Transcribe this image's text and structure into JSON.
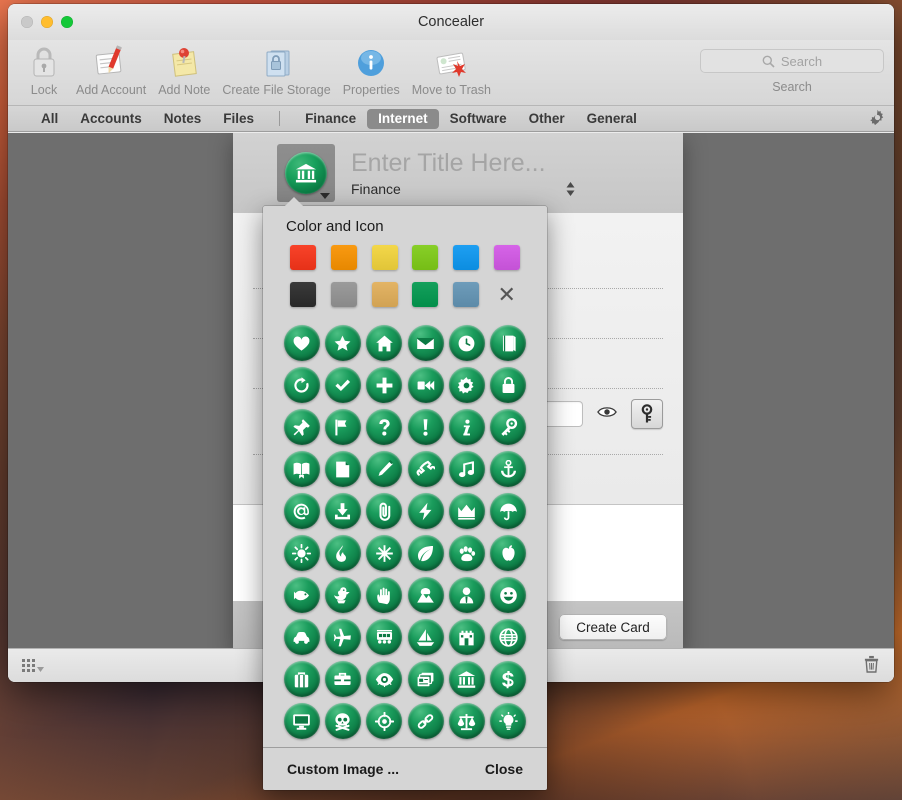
{
  "window": {
    "title": "Concealer",
    "traffic_lights": [
      "close",
      "minimize",
      "maximize"
    ]
  },
  "toolbar": {
    "items": [
      {
        "label": "Lock",
        "icon": "padlock-icon"
      },
      {
        "label": "Add Account",
        "icon": "note-pencil-icon"
      },
      {
        "label": "Add Note",
        "icon": "sticky-note-icon"
      },
      {
        "label": "Create File Storage",
        "icon": "locked-folder-icon"
      },
      {
        "label": "Properties",
        "icon": "info-circle-icon"
      },
      {
        "label": "Move to Trash",
        "icon": "card-delete-icon"
      }
    ],
    "search": {
      "placeholder": "Search",
      "label": "Search"
    }
  },
  "filterbar": {
    "left_tabs": [
      "All",
      "Accounts",
      "Notes",
      "Files"
    ],
    "right_tabs": [
      "Finance",
      "Internet",
      "Software",
      "Other",
      "General"
    ],
    "selected": "Internet",
    "gear": "gear-icon"
  },
  "sheet": {
    "title_placeholder": "Enter Title Here...",
    "category_value": "Finance",
    "selected_icon": "bank-icon",
    "create_button": "Create Card",
    "reveal_icon": "eye-icon",
    "generate_icon": "key-icon"
  },
  "statusbar": {
    "left_icon": "grid-view-icon",
    "right_icon": "trash-icon"
  },
  "popover": {
    "title": "Color and Icon",
    "custom_image_label": "Custom Image ...",
    "close_label": "Close",
    "colors": [
      {
        "name": "red",
        "hex": "#f8432a"
      },
      {
        "name": "orange",
        "hex": "#f99a12"
      },
      {
        "name": "yellow",
        "hex": "#f3d74a"
      },
      {
        "name": "green",
        "hex": "#88cf28"
      },
      {
        "name": "blue",
        "hex": "#1e9ff2"
      },
      {
        "name": "magenta",
        "hex": "#d664e8"
      },
      {
        "name": "black",
        "hex": "#3a3a3a"
      },
      {
        "name": "gray",
        "hex": "#9b9b9b"
      },
      {
        "name": "tan",
        "hex": "#e3b465"
      },
      {
        "name": "dark-green",
        "hex": "#14a05c"
      },
      {
        "name": "steel-blue",
        "hex": "#6e9cba"
      },
      {
        "name": "none",
        "hex": "none"
      }
    ],
    "selected_color": "dark-green",
    "icons": [
      "heart",
      "star",
      "home",
      "envelope",
      "clock",
      "book",
      "refresh",
      "check",
      "plus",
      "fast-forward",
      "gear",
      "lock",
      "pushpin",
      "flag",
      "question",
      "exclamation",
      "info",
      "key",
      "open-book",
      "page",
      "pencil",
      "phone",
      "music-note",
      "anchor",
      "at-sign",
      "download",
      "paperclip",
      "lightning",
      "crown",
      "umbrella",
      "sun",
      "flame",
      "snowflake",
      "leaf",
      "paw",
      "apple",
      "fish",
      "duck",
      "hand",
      "mountain",
      "person",
      "smiley",
      "car",
      "airplane",
      "train",
      "sailboat",
      "castle",
      "globe",
      "suitcase",
      "briefcase",
      "eye",
      "cards",
      "bank",
      "dollar",
      "monitor",
      "skull",
      "target",
      "chain",
      "scales",
      "lightbulb"
    ]
  }
}
